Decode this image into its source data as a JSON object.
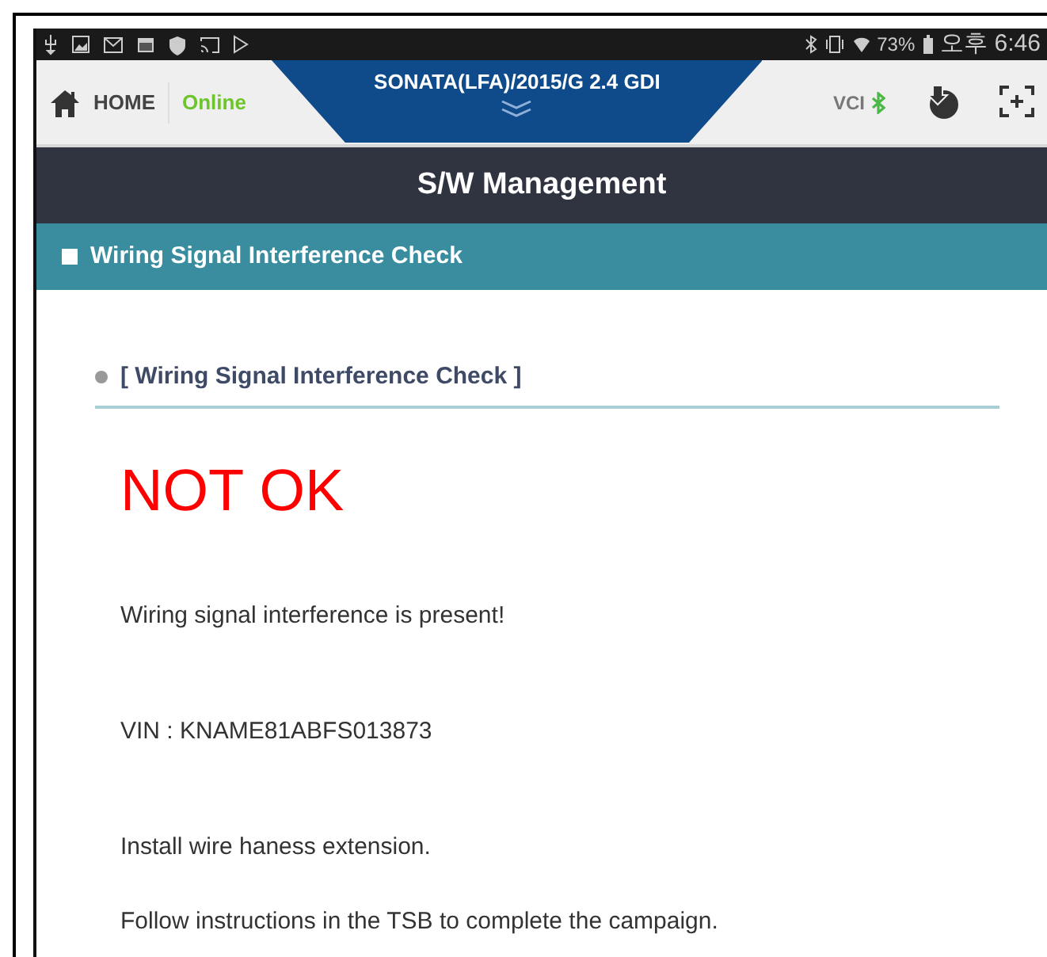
{
  "status_bar": {
    "battery": "73%",
    "time": "오후 6:46"
  },
  "header": {
    "home_label": "HOME",
    "connection": "Online",
    "vehicle": "SONATA(LFA)/2015/G 2.4 GDI",
    "vci_label": "VCI"
  },
  "title": "S/W Management",
  "section": {
    "title": "Wiring Signal Interference Check"
  },
  "content": {
    "heading": "[ Wiring Signal Interference Check ]",
    "result": "NOT OK",
    "paragraphs": [
      "Wiring signal interference is present!",
      "VIN : KNAME81ABFS013873",
      "Install wire haness extension.",
      "Follow instructions in the TSB to complete the campaign."
    ]
  }
}
